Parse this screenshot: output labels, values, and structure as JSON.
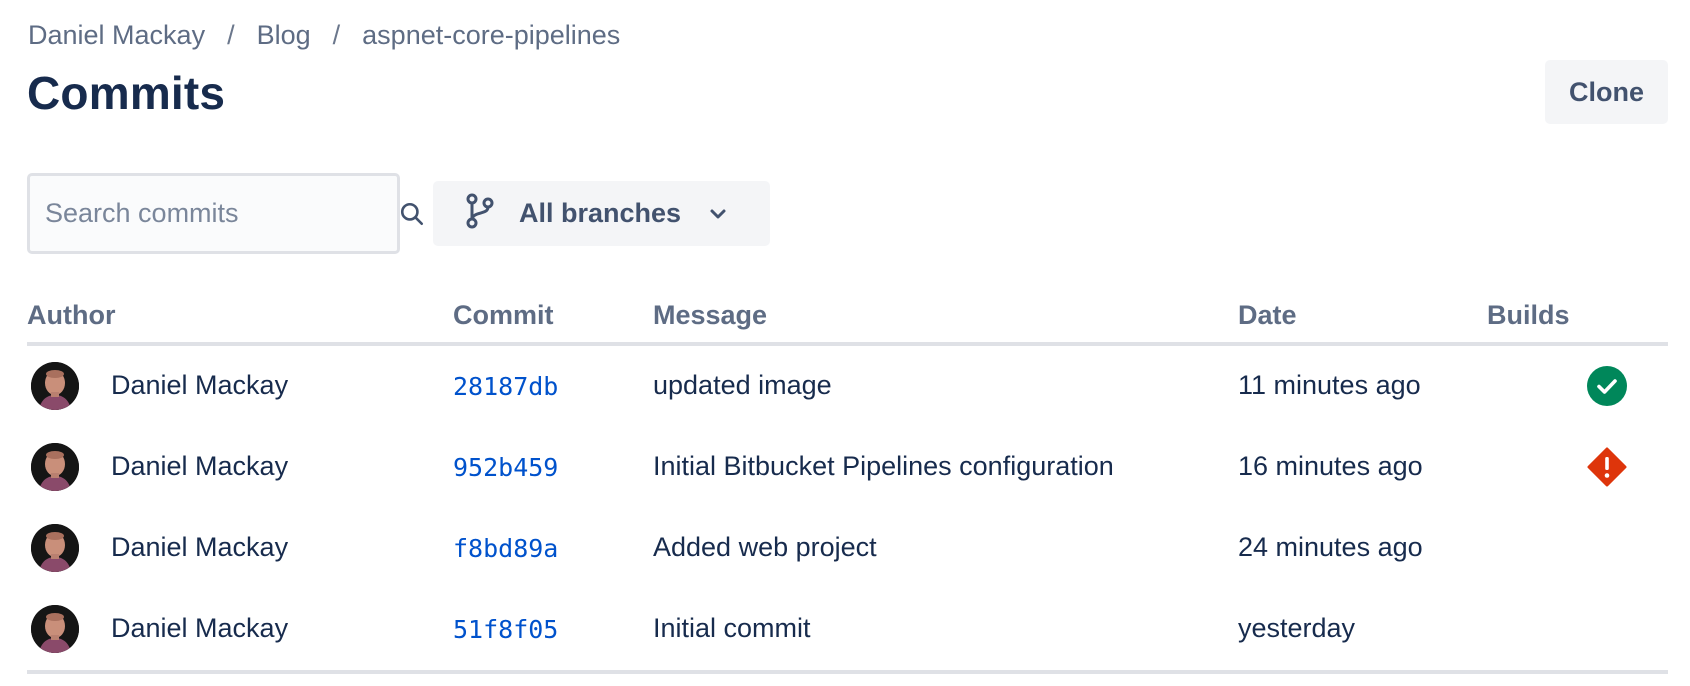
{
  "breadcrumb": {
    "items": [
      "Daniel Mackay",
      "Blog",
      "aspnet-core-pipelines"
    ],
    "separator": "/"
  },
  "header": {
    "title": "Commits",
    "clone_label": "Clone"
  },
  "search": {
    "placeholder": "Search commits",
    "icon": "search-icon"
  },
  "branch_filter": {
    "label": "All branches",
    "icon": "branch-icon"
  },
  "table": {
    "columns": [
      "Author",
      "Commit",
      "Message",
      "Date",
      "Builds"
    ],
    "rows": [
      {
        "author": "Daniel Mackay",
        "commit": "28187db",
        "message": "updated image",
        "date": "11 minutes ago",
        "build": "success"
      },
      {
        "author": "Daniel Mackay",
        "commit": "952b459",
        "message": "Initial Bitbucket Pipelines configuration",
        "date": "16 minutes ago",
        "build": "failed"
      },
      {
        "author": "Daniel Mackay",
        "commit": "f8bd89a",
        "message": "Added web project",
        "date": "24 minutes ago",
        "build": ""
      },
      {
        "author": "Daniel Mackay",
        "commit": "51f8f05",
        "message": "Initial commit",
        "date": "yesterday",
        "build": ""
      }
    ]
  },
  "colors": {
    "success": "#00875a",
    "failed": "#de350b",
    "link": "#0052cc"
  }
}
